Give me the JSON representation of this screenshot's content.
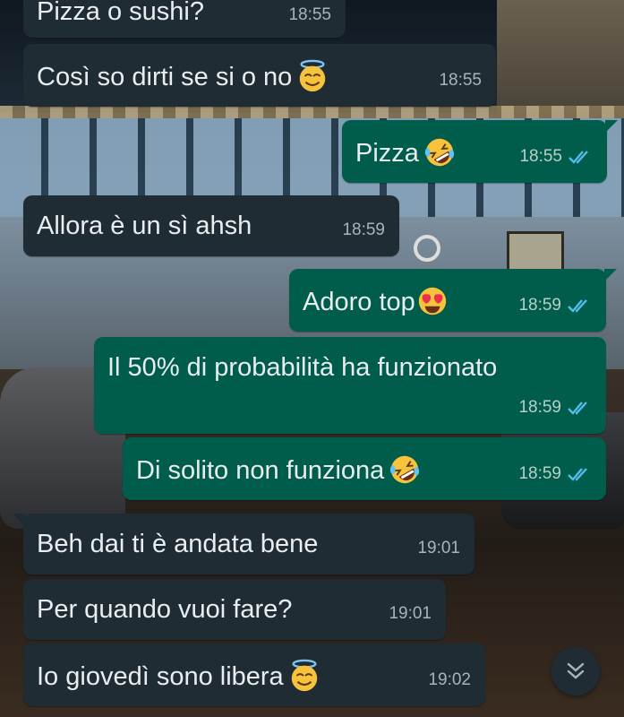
{
  "messages": [
    {
      "id": "m1",
      "direction": "incoming",
      "text": "Pizza o sushi?",
      "time": "18:55"
    },
    {
      "id": "m2",
      "direction": "incoming",
      "text": "Così so dirti se si o no",
      "emoji": "smiling-face-with-halo",
      "time": "18:55"
    },
    {
      "id": "m3",
      "direction": "outgoing",
      "text": "Pizza",
      "emoji": "rolling-on-the-floor-laughing",
      "time": "18:55",
      "status": "read"
    },
    {
      "id": "m4",
      "direction": "incoming",
      "text": "Allora è un sì ahsh",
      "time": "18:59"
    },
    {
      "id": "m5",
      "direction": "outgoing",
      "text": "Adoro top",
      "emoji": "smiling-face-with-heart-eyes",
      "time": "18:59",
      "status": "read"
    },
    {
      "id": "m6",
      "direction": "outgoing",
      "text": "Il 50% di probabilità ha funzionato",
      "time": "18:59",
      "status": "read"
    },
    {
      "id": "m7",
      "direction": "outgoing",
      "text": "Di solito non funziona",
      "emoji": "rolling-on-the-floor-laughing",
      "time": "18:59",
      "status": "read"
    },
    {
      "id": "m8",
      "direction": "incoming",
      "text": "Beh dai ti è andata bene",
      "time": "19:01"
    },
    {
      "id": "m9",
      "direction": "incoming",
      "text": "Per quando vuoi fare?",
      "time": "19:01"
    },
    {
      "id": "m10",
      "direction": "incoming",
      "text": "Io giovedì sono libera",
      "emoji": "smiling-face-with-halo",
      "time": "19:02"
    }
  ],
  "controls": {
    "scroll_to_bottom_icon": "double-chevron-down-icon"
  },
  "colors": {
    "incoming_bubble": "#1f2c34",
    "outgoing_bubble": "#005c4b",
    "text": "#e9edef",
    "read_tick": "#53bdeb"
  }
}
